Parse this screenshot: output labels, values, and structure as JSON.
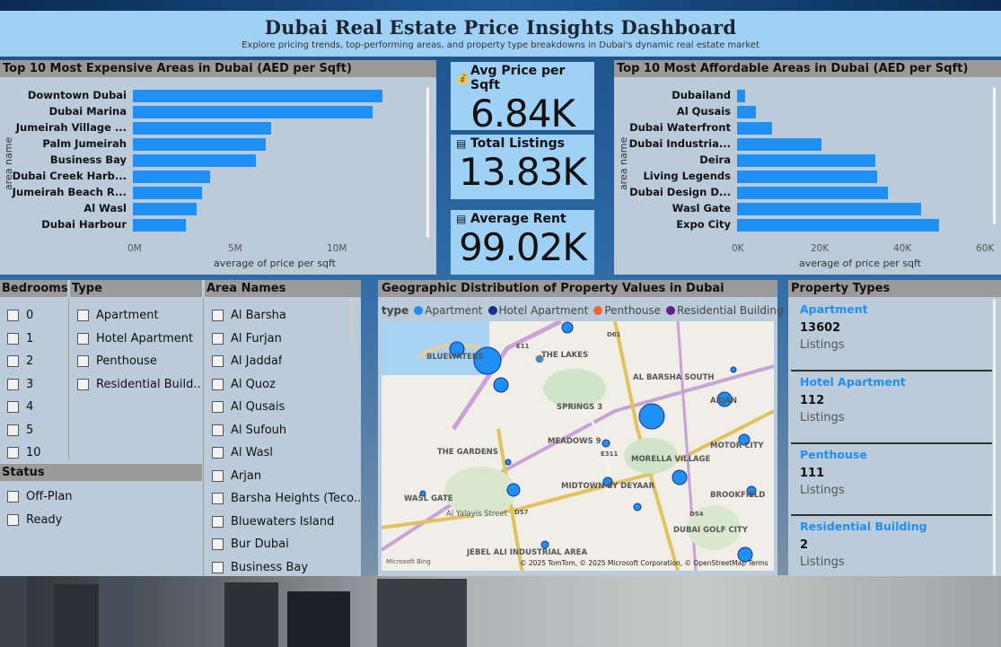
{
  "header": {
    "title": "Dubai Real Estate Price Insights Dashboard",
    "subtitle": "Explore pricing trends, top-performing areas, and property type breakdowns in Dubai's dynamic real estate market"
  },
  "expensive": {
    "title": "Top 10 Most Expensive Areas in Dubai (AED per Sqft)",
    "y_axis_title": "area name",
    "x_axis_title": "average of price per sqft",
    "ticks": [
      "0M",
      "5M",
      "10M"
    ]
  },
  "affordable": {
    "title": "Top 10 Most Affordable Areas in Dubai (AED per Sqft)",
    "y_axis_title": "area name",
    "x_axis_title": "average of price per sqft",
    "ticks": [
      "0K",
      "20K",
      "40K",
      "60K"
    ]
  },
  "chart_data": [
    {
      "type": "bar",
      "orientation": "horizontal",
      "title": "Top 10 Most Expensive Areas in Dubai (AED per Sqft)",
      "ylabel": "area name",
      "xlabel": "average of price per sqft",
      "categories": [
        "Downtown Dubai",
        "Dubai Marina",
        "Jumeirah Village ...",
        "Palm Jumeirah",
        "Business Bay",
        "Dubai Creek Harb...",
        "Jumeirah Beach R...",
        "Al Wasl",
        "Dubai Harbour"
      ],
      "values": [
        12600000,
        12100000,
        7000000,
        6700000,
        6200000,
        3900000,
        3500000,
        3200000,
        2700000
      ],
      "xlim": [
        0,
        12800000
      ]
    },
    {
      "type": "bar",
      "orientation": "horizontal",
      "title": "Top 10 Most Affordable Areas in Dubai (AED per Sqft)",
      "ylabel": "area name",
      "xlabel": "average of price per sqft",
      "categories": [
        "Dubailand",
        "Al Qusais",
        "Dubai Waterfront",
        "Dubai Industria...",
        "Deira",
        "Living Legends",
        "Dubai Design D...",
        "Wasl Gate",
        "Expo City"
      ],
      "values": [
        2000,
        4500,
        8500,
        20500,
        33500,
        34000,
        36500,
        44500,
        49000
      ],
      "xlim": [
        0,
        60000
      ]
    }
  ],
  "kpis": [
    {
      "label": "Avg Price per Sqft",
      "value": "6.84K",
      "icon": "money-bag-icon"
    },
    {
      "label": "Total Listings",
      "value": "13.83K",
      "icon": "document-icon"
    },
    {
      "label": "Average Rent",
      "value": "99.02K",
      "icon": "document-icon"
    }
  ],
  "slicers": {
    "bedrooms": {
      "title": "Bedrooms",
      "options": [
        "0",
        "1",
        "2",
        "3",
        "4",
        "5",
        "10"
      ]
    },
    "type": {
      "title": "Type",
      "options": [
        "Apartment",
        "Hotel Apartment",
        "Penthouse",
        "Residential Build..."
      ]
    },
    "status": {
      "title": "Status",
      "options": [
        "Off-Plan",
        "Ready"
      ]
    },
    "areas": {
      "title": "Area Names",
      "options": [
        "Al Barsha",
        "Al Furjan",
        "Al Jaddaf",
        "Al Quoz",
        "Al Qusais",
        "Al Sufouh",
        "Al Wasl",
        "Arjan",
        "Barsha Heights (Teco...",
        "Bluewaters Island",
        "Bur Dubai",
        "Business Bay"
      ]
    }
  },
  "map": {
    "title": "Geographic Distribution of Property Values in Dubai",
    "legend_label": "type",
    "legend": [
      {
        "name": "Apartment",
        "color": "#1e90f5"
      },
      {
        "name": "Hotel Apartment",
        "color": "#14328c"
      },
      {
        "name": "Penthouse",
        "color": "#e8683a"
      },
      {
        "name": "Residential Building",
        "color": "#6b1a8c"
      }
    ],
    "place_labels": [
      "BLUEWATERS",
      "THE LAKES",
      "SPRINGS 3",
      "AL BARSHA SOUTH",
      "MEADOWS 9",
      "THE GARDENS",
      "MORELLA VILLAGE",
      "MIDTOWN BY DEYAAR",
      "MOTOR CITY",
      "BROOKFIELD",
      "WASL GATE",
      "Al Yalayis Street",
      "DUBAI GOLF CITY",
      "JEBEL ALI INDUSTRIAL AREA",
      "ARJAN",
      "E11",
      "E311",
      "D57",
      "D54",
      "D61"
    ],
    "attribution": "© 2025 TomTom, © 2025 Microsoft Corporation, © OpenStreetMap  Terms",
    "brand": "Microsoft Bing"
  },
  "property_types": {
    "title": "Property Types",
    "items": [
      {
        "name": "Apartment",
        "count": "13602",
        "unit": "Listings"
      },
      {
        "name": "Hotel Apartment",
        "count": "112",
        "unit": "Listings"
      },
      {
        "name": "Penthouse",
        "count": "111",
        "unit": "Listings"
      },
      {
        "name": "Residential Building",
        "count": "2",
        "unit": "Listings"
      }
    ]
  }
}
